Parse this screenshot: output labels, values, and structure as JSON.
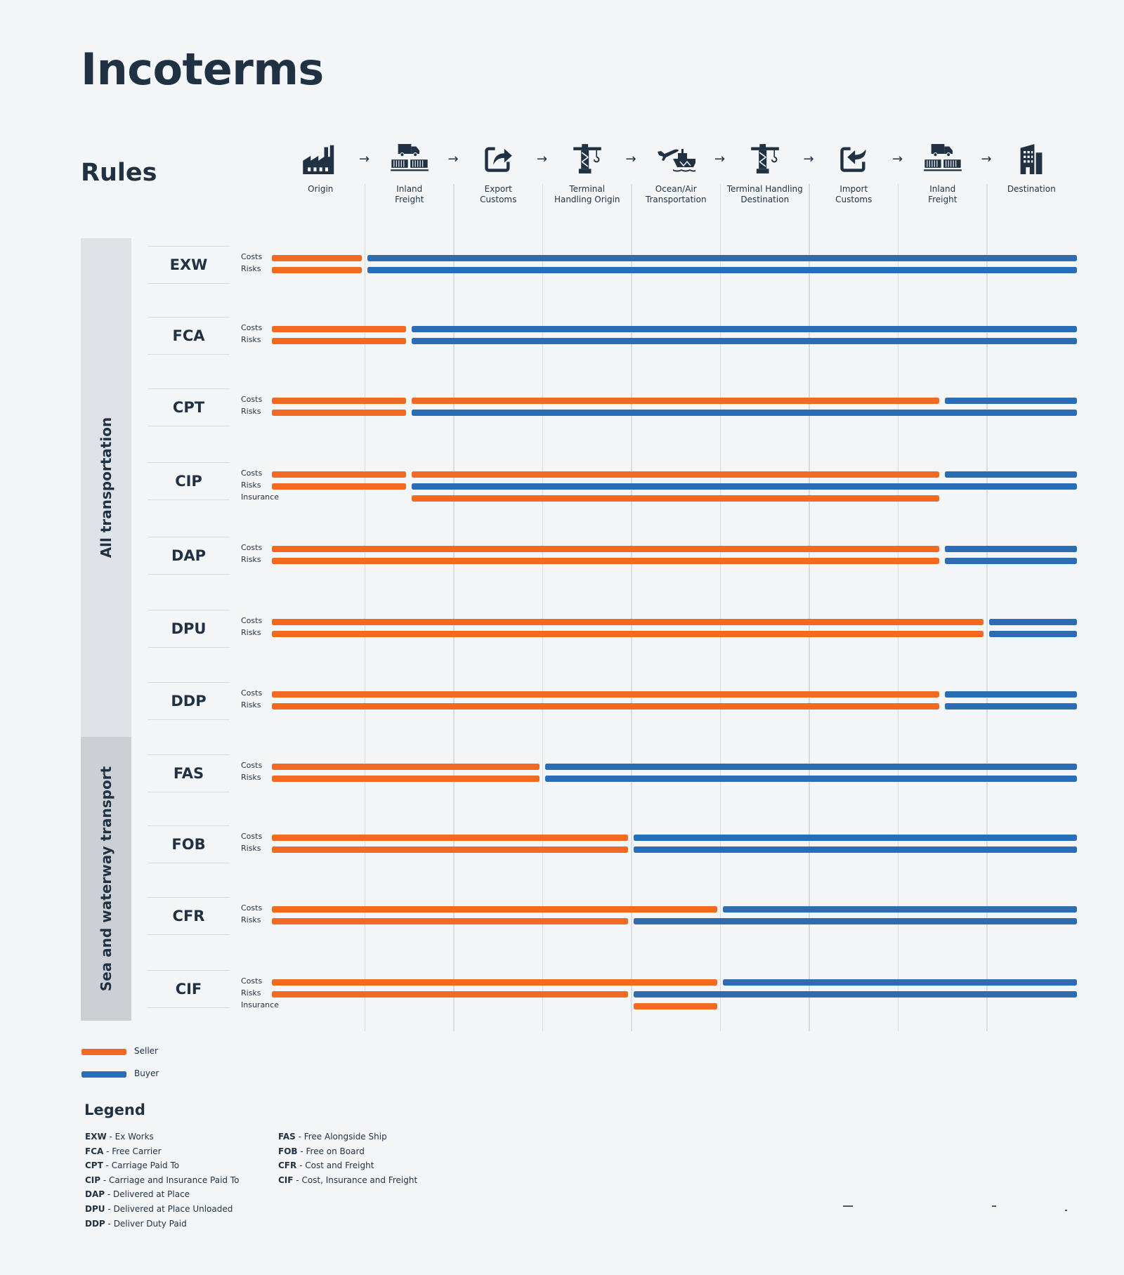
{
  "title": "Incoterms",
  "rules_title": "Rules",
  "colors": {
    "seller": "#f26a22",
    "buyer": "#2a6db5",
    "text": "#1f3143",
    "background": "#f3f5f7"
  },
  "stages": [
    {
      "label": "Origin",
      "icon": "factory-icon"
    },
    {
      "label": "Inland\nFreight",
      "icon": "truck-freight-icon"
    },
    {
      "label": "Export\nCustoms",
      "icon": "export-customs-icon"
    },
    {
      "label": "Terminal\nHandling Origin",
      "icon": "crane-icon"
    },
    {
      "label": "Ocean/Air\nTransportation",
      "icon": "plane-ship-icon"
    },
    {
      "label": "Terminal Handling\nDestination",
      "icon": "crane-icon"
    },
    {
      "label": "Import\nCustoms",
      "icon": "import-customs-icon"
    },
    {
      "label": "Inland\nFreight",
      "icon": "truck-freight-icon"
    },
    {
      "label": "Destination",
      "icon": "building-icon"
    }
  ],
  "arrow_glyph": "→",
  "groups": [
    {
      "label": "All transportation"
    },
    {
      "label": "Sea and waterway transport"
    }
  ],
  "line_labels": {
    "costs": "Costs",
    "risks": "Risks",
    "insurance": "Insurance"
  },
  "chart_data": {
    "type": "gantt",
    "title": "Incoterms",
    "scale_note": "positions in stage units 0-9 (0 = Origin start, 9 = Destination end)",
    "categories": [
      "Origin",
      "Inland Freight",
      "Export Customs",
      "Terminal Handling Origin",
      "Ocean/Air Transportation",
      "Terminal Handling Destination",
      "Import Customs",
      "Inland Freight",
      "Destination"
    ],
    "legend": [
      {
        "name": "Seller",
        "color": "#f26a22"
      },
      {
        "name": "Buyer",
        "color": "#2a6db5"
      }
    ],
    "rules": [
      {
        "code": "EXW",
        "group": 0,
        "costs": [
          [
            0,
            1,
            "seller"
          ],
          [
            1,
            9,
            "buyer"
          ]
        ],
        "risks": [
          [
            0,
            1,
            "seller"
          ],
          [
            1,
            9,
            "buyer"
          ]
        ]
      },
      {
        "code": "FCA",
        "group": 0,
        "costs": [
          [
            0,
            1.5,
            "seller"
          ],
          [
            1.5,
            9,
            "buyer"
          ]
        ],
        "risks": [
          [
            0,
            1.5,
            "seller"
          ],
          [
            1.5,
            9,
            "buyer"
          ]
        ]
      },
      {
        "code": "CPT",
        "group": 0,
        "costs": [
          [
            0,
            1.5,
            "seller"
          ],
          [
            1.5,
            7.5,
            "seller"
          ],
          [
            7.5,
            9,
            "buyer"
          ]
        ],
        "risks": [
          [
            0,
            1.5,
            "seller"
          ],
          [
            1.5,
            9,
            "buyer"
          ]
        ]
      },
      {
        "code": "CIP",
        "group": 0,
        "costs": [
          [
            0,
            1.5,
            "seller"
          ],
          [
            1.5,
            7.5,
            "seller"
          ],
          [
            7.5,
            9,
            "buyer"
          ]
        ],
        "risks": [
          [
            0,
            1.5,
            "seller"
          ],
          [
            1.5,
            9,
            "buyer"
          ]
        ],
        "insurance": [
          [
            1.5,
            7.5,
            "seller"
          ]
        ]
      },
      {
        "code": "DAP",
        "group": 0,
        "costs": [
          [
            0,
            7.5,
            "seller"
          ],
          [
            7.5,
            9,
            "buyer"
          ]
        ],
        "risks": [
          [
            0,
            7.5,
            "seller"
          ],
          [
            7.5,
            9,
            "buyer"
          ]
        ]
      },
      {
        "code": "DPU",
        "group": 0,
        "costs": [
          [
            0,
            8,
            "seller"
          ],
          [
            8,
            9,
            "buyer"
          ]
        ],
        "risks": [
          [
            0,
            8,
            "seller"
          ],
          [
            8,
            9,
            "buyer"
          ]
        ]
      },
      {
        "code": "DDP",
        "group": 0,
        "costs": [
          [
            0,
            7.5,
            "seller"
          ],
          [
            7.5,
            9,
            "buyer"
          ]
        ],
        "risks": [
          [
            0,
            7.5,
            "seller"
          ],
          [
            7.5,
            9,
            "buyer"
          ]
        ]
      },
      {
        "code": "FAS",
        "group": 1,
        "costs": [
          [
            0,
            3,
            "seller"
          ],
          [
            3,
            9,
            "buyer"
          ]
        ],
        "risks": [
          [
            0,
            3,
            "seller"
          ],
          [
            3,
            9,
            "buyer"
          ]
        ]
      },
      {
        "code": "FOB",
        "group": 1,
        "costs": [
          [
            0,
            4,
            "seller"
          ],
          [
            4,
            9,
            "buyer"
          ]
        ],
        "risks": [
          [
            0,
            4,
            "seller"
          ],
          [
            4,
            9,
            "buyer"
          ]
        ]
      },
      {
        "code": "CFR",
        "group": 1,
        "costs": [
          [
            0,
            5,
            "seller"
          ],
          [
            5,
            9,
            "buyer"
          ]
        ],
        "risks": [
          [
            0,
            4,
            "seller"
          ],
          [
            4,
            9,
            "buyer"
          ]
        ]
      },
      {
        "code": "CIF",
        "group": 1,
        "costs": [
          [
            0,
            5,
            "seller"
          ],
          [
            5,
            9,
            "buyer"
          ]
        ],
        "risks": [
          [
            0,
            4,
            "seller"
          ],
          [
            4,
            9,
            "buyer"
          ]
        ],
        "insurance": [
          [
            4,
            5,
            "seller"
          ]
        ]
      }
    ]
  },
  "key": [
    {
      "label": "Seller",
      "party": "seller"
    },
    {
      "label": "Buyer",
      "party": "buyer"
    }
  ],
  "legend": {
    "title": "Legend",
    "columns": [
      [
        {
          "code": "EXW",
          "name": "Ex Works"
        },
        {
          "code": "FCA",
          "name": "Free Carrier"
        },
        {
          "code": "CPT",
          "name": "Carriage Paid To"
        },
        {
          "code": "CIP",
          "name": "Carriage and Insurance Paid To"
        },
        {
          "code": "DAP",
          "name": "Delivered at Place"
        },
        {
          "code": "DPU",
          "name": "Delivered at Place Unloaded"
        },
        {
          "code": "DDP",
          "name": "Deliver Duty Paid"
        }
      ],
      [
        {
          "code": "FAS",
          "name": "Free Alongside Ship"
        },
        {
          "code": "FOB",
          "name": "Free on Board"
        },
        {
          "code": "CFR",
          "name": "Cost and Freight"
        },
        {
          "code": "CIF",
          "name": "Cost, Insurance and Freight"
        }
      ]
    ]
  }
}
